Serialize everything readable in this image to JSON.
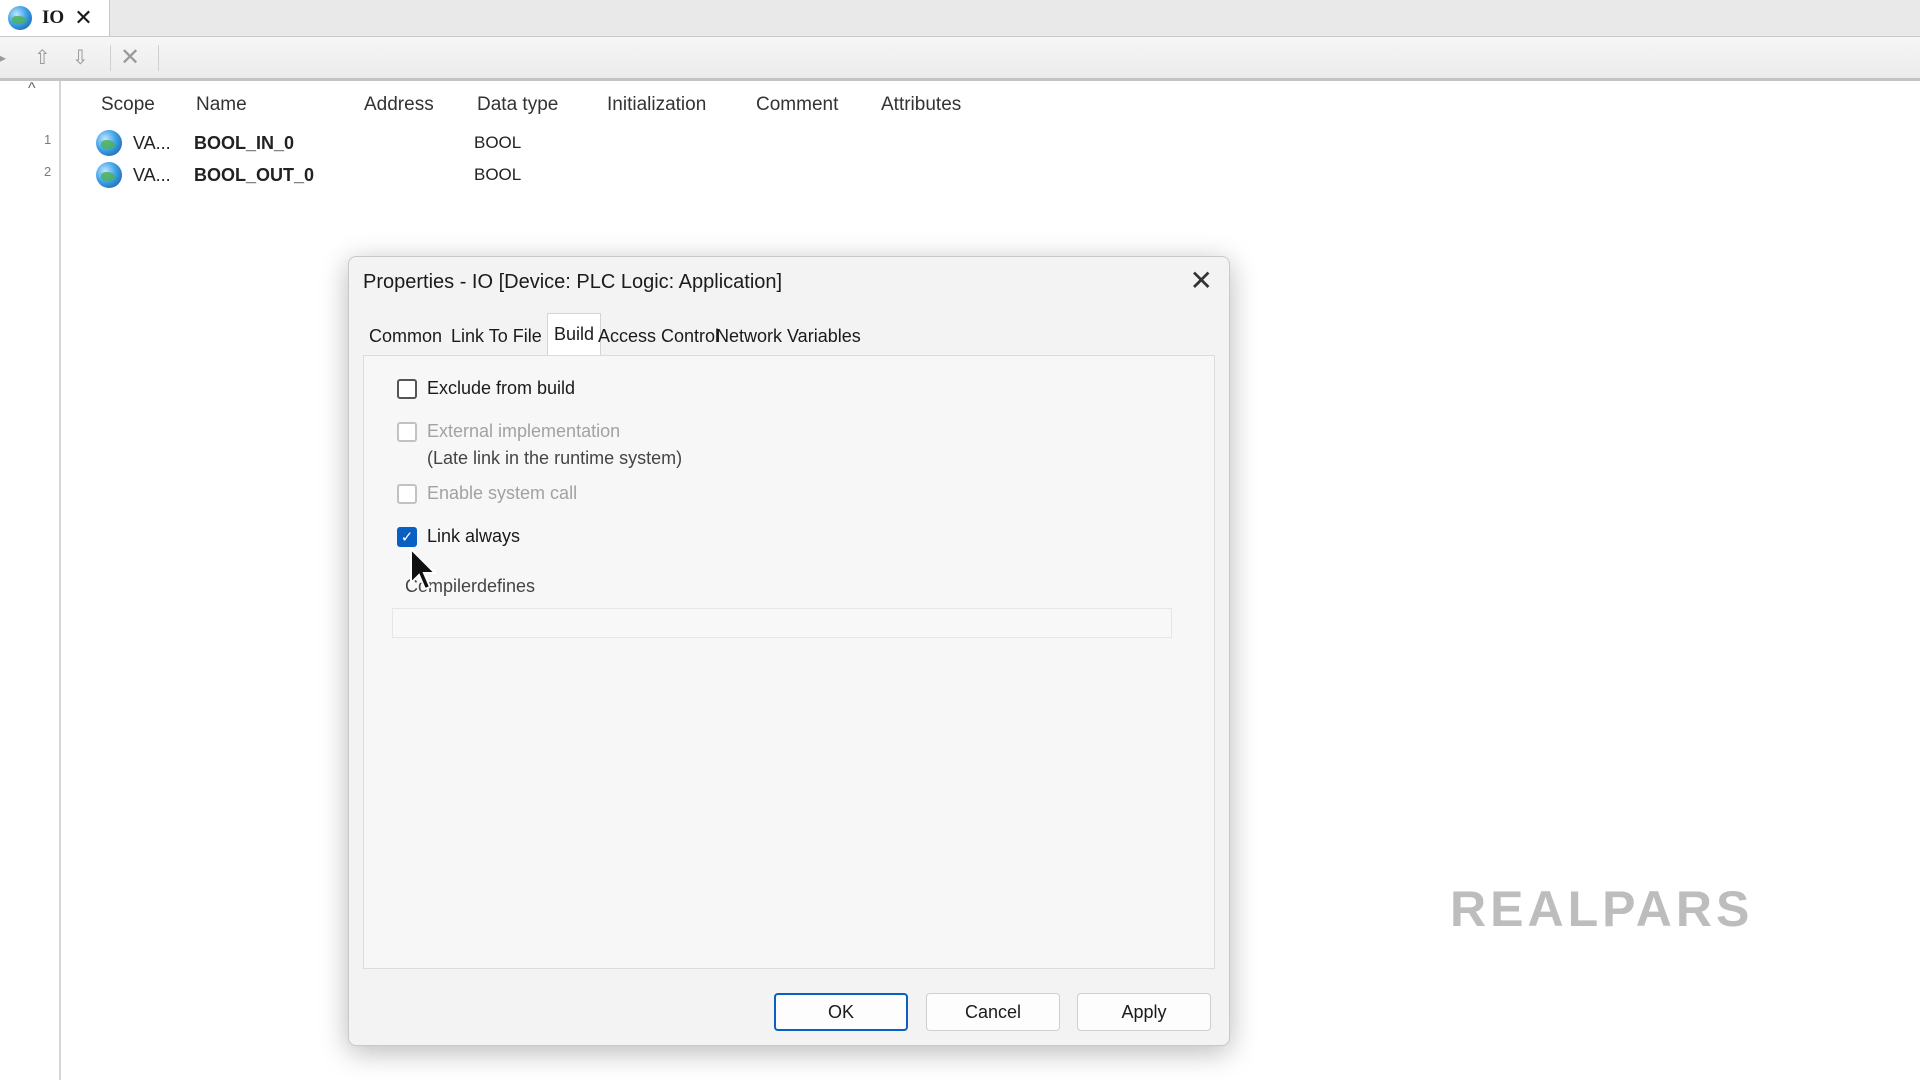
{
  "editor_tab": {
    "title": "IO",
    "close": "✕"
  },
  "table": {
    "headers": [
      "Scope",
      "Name",
      "Address",
      "Data type",
      "Initialization",
      "Comment",
      "Attributes"
    ],
    "rows": [
      {
        "line": "1",
        "scope": "VA...",
        "name": "BOOL_IN_0",
        "data_type": "BOOL"
      },
      {
        "line": "2",
        "scope": "VA...",
        "name": "BOOL_OUT_0",
        "data_type": "BOOL"
      }
    ]
  },
  "dialog": {
    "title": "Properties - IO [Device: PLC Logic: Application]",
    "tabs": [
      "Common",
      "Link To File",
      "Build",
      "Access Control",
      "Network Variables"
    ],
    "active_tab": "Build",
    "options": {
      "exclude_from_build": {
        "label": "Exclude from build",
        "checked": false,
        "enabled": true
      },
      "external_implementation": {
        "label": "External implementation",
        "note": "(Late link in the runtime system)",
        "checked": false,
        "enabled": false
      },
      "enable_system_call": {
        "label": "Enable system call",
        "checked": false,
        "enabled": false
      },
      "link_always": {
        "label": "Link always",
        "checked": true,
        "enabled": true
      }
    },
    "compiler_defines_label": "Compilerdefines",
    "compiler_defines_value": "",
    "buttons": {
      "ok": "OK",
      "cancel": "Cancel",
      "apply": "Apply"
    }
  },
  "watermark": "REALPARS",
  "colors": {
    "accent": "#0a5fc2",
    "dialog_bg": "#f3f3f3",
    "watermark": "#bdbdbd"
  }
}
